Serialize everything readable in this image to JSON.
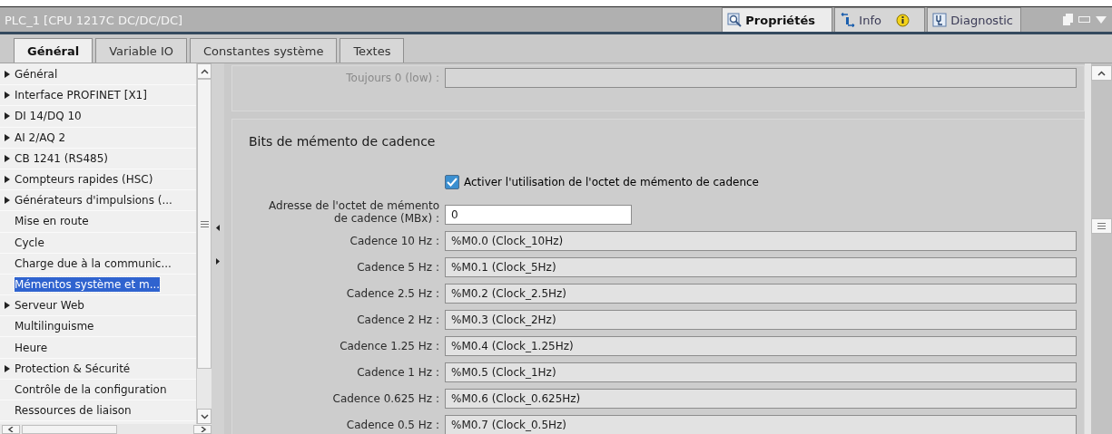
{
  "window": {
    "title": "PLC_1 [CPU 1217C DC/DC/DC]"
  },
  "inspector_tabs": [
    {
      "label": "Propriétés",
      "kind": "properties",
      "selected": true
    },
    {
      "label": "Info",
      "kind": "info",
      "selected": false
    },
    {
      "label": "Diagnostic",
      "kind": "diagnostic",
      "selected": false
    }
  ],
  "tabs": [
    {
      "label": "Général",
      "selected": true
    },
    {
      "label": "Variable IO",
      "selected": false
    },
    {
      "label": "Constantes système",
      "selected": false
    },
    {
      "label": "Textes",
      "selected": false
    }
  ],
  "nav": {
    "items": [
      {
        "label": "Général",
        "expandable": true,
        "selected": false
      },
      {
        "label": "Interface PROFINET [X1]",
        "expandable": true,
        "selected": false
      },
      {
        "label": "DI 14/DQ 10",
        "expandable": true,
        "selected": false
      },
      {
        "label": "AI 2/AQ 2",
        "expandable": true,
        "selected": false
      },
      {
        "label": "CB 1241 (RS485)",
        "expandable": true,
        "selected": false
      },
      {
        "label": "Compteurs rapides (HSC)",
        "expandable": true,
        "selected": false
      },
      {
        "label": "Générateurs d'impulsions (...",
        "expandable": true,
        "selected": false
      },
      {
        "label": "Mise en route",
        "expandable": false,
        "selected": false
      },
      {
        "label": "Cycle",
        "expandable": false,
        "selected": false
      },
      {
        "label": "Charge due à la communic...",
        "expandable": false,
        "selected": false
      },
      {
        "label": "Mémentos système et m...",
        "expandable": false,
        "selected": true
      },
      {
        "label": "Serveur Web",
        "expandable": true,
        "selected": false
      },
      {
        "label": "Multilinguisme",
        "expandable": false,
        "selected": false
      },
      {
        "label": "Heure",
        "expandable": false,
        "selected": false
      },
      {
        "label": "Protection & Sécurité",
        "expandable": true,
        "selected": false
      },
      {
        "label": "Contrôle de la configuration",
        "expandable": false,
        "selected": false
      },
      {
        "label": "Ressources de liaison",
        "expandable": false,
        "selected": false
      }
    ]
  },
  "system_section": {
    "rows": [
      {
        "label": "Toujours 0 (low) :",
        "disabled": true
      }
    ]
  },
  "clock_section": {
    "title": "Bits de mémento de cadence",
    "enable": {
      "label": "Activer l'utilisation de l'octet de mémento de cadence",
      "checked": true
    },
    "address": {
      "label": "Adresse de l'octet de mémento de cadence (MBx) :",
      "value": "0"
    },
    "rows": [
      {
        "label": "Cadence 10 Hz :",
        "value": "%M0.0 (Clock_10Hz)"
      },
      {
        "label": "Cadence 5 Hz :",
        "value": "%M0.1 (Clock_5Hz)"
      },
      {
        "label": "Cadence 2.5 Hz :",
        "value": "%M0.2 (Clock_2.5Hz)"
      },
      {
        "label": "Cadence 2 Hz :",
        "value": "%M0.3 (Clock_2Hz)"
      },
      {
        "label": "Cadence 1.25 Hz :",
        "value": "%M0.4 (Clock_1.25Hz)"
      },
      {
        "label": "Cadence 1 Hz :",
        "value": "%M0.5 (Clock_1Hz)"
      },
      {
        "label": "Cadence 0.625 Hz :",
        "value": "%M0.6 (Clock_0.625Hz)"
      },
      {
        "label": "Cadence 0.5 Hz :",
        "value": "%M0.7 (Clock_0.5Hz)"
      }
    ]
  }
}
